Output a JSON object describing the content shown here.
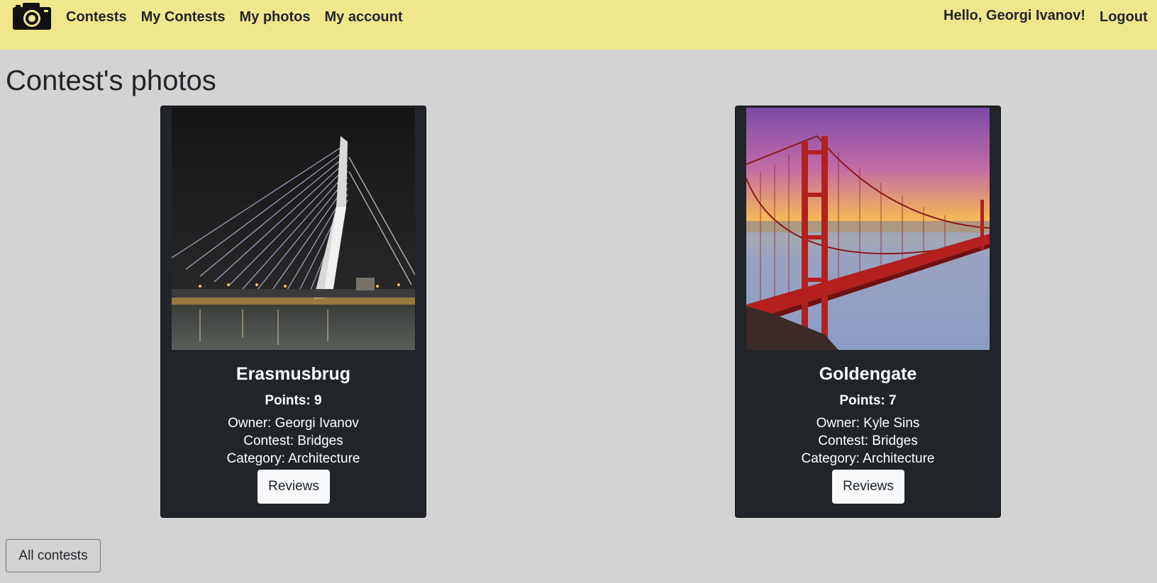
{
  "nav": {
    "links": [
      "Contests",
      "My Contests",
      "My photos",
      "My account"
    ],
    "greeting": "Hello, Georgi Ivanov!",
    "logout": "Logout"
  },
  "page_title": "Contest's photos",
  "photos": [
    {
      "title": "Erasmusbrug",
      "points": "Points: 9",
      "owner": "Owner: Georgi Ivanov",
      "contest": "Contest: Bridges",
      "category": "Category: Architecture",
      "reviews_label": "Reviews"
    },
    {
      "title": "Goldengate",
      "points": "Points: 7",
      "owner": "Owner: Kyle Sins",
      "contest": "Contest: Bridges",
      "category": "Category: Architecture",
      "reviews_label": "Reviews"
    }
  ],
  "all_contests_label": "All contests",
  "colors": {
    "navbar": "#f0e68c",
    "background": "#d3d3d3",
    "card": "#212529",
    "bridge_red": "#b3201e"
  }
}
